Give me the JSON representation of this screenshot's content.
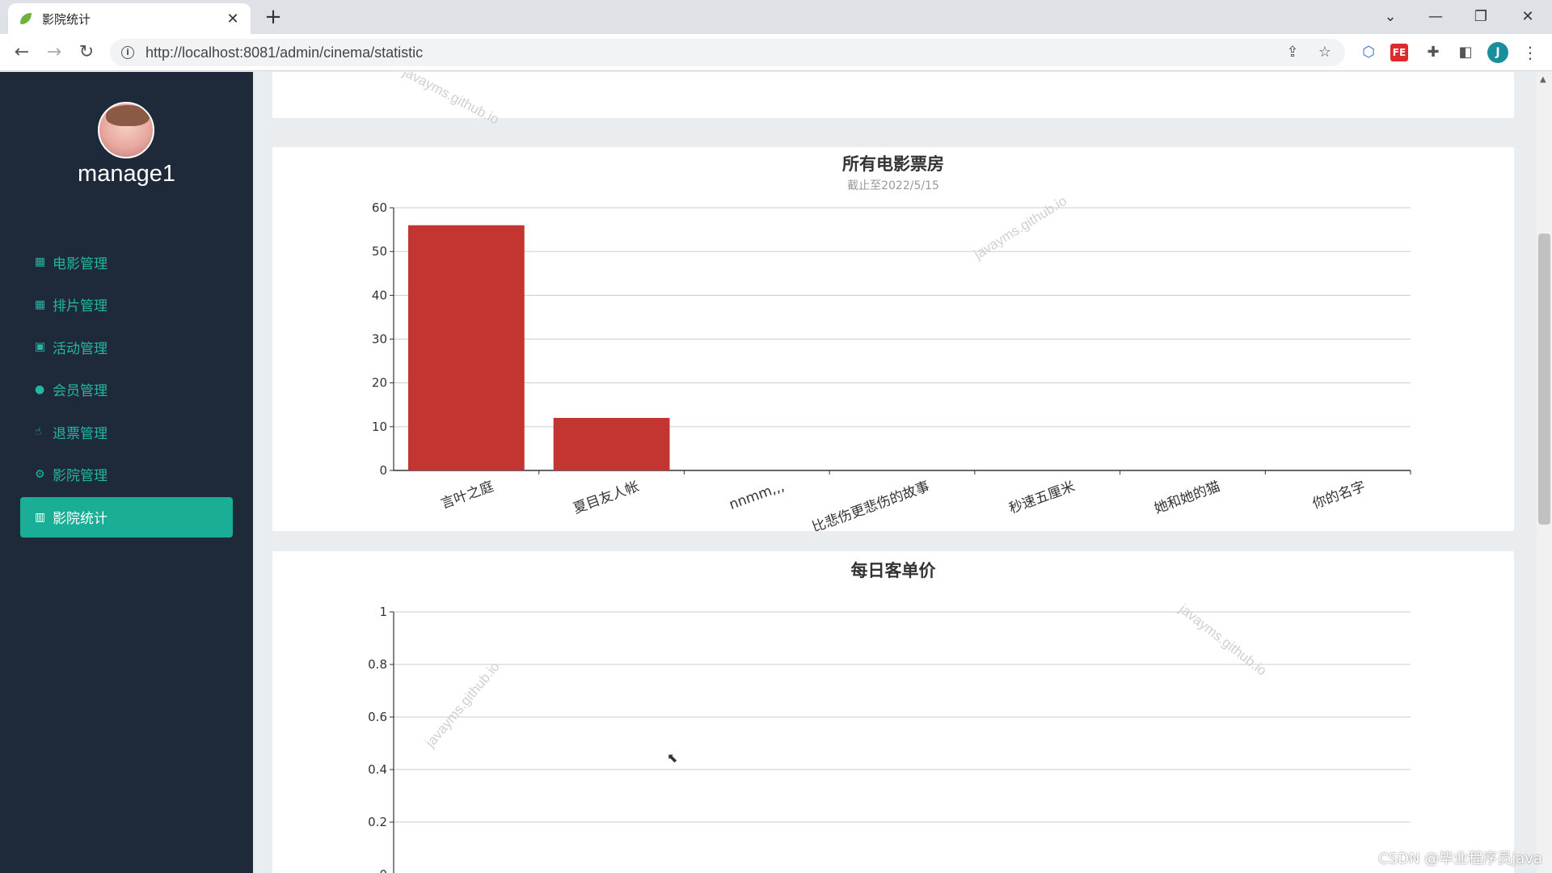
{
  "browser": {
    "tab_title": "影院统计",
    "url": "http://localhost:8081/admin/cinema/statistic",
    "profile_initial": "J"
  },
  "sidebar": {
    "username": "manage1",
    "items": [
      {
        "label": "电影管理",
        "icon": "film-icon",
        "glyph": "▦"
      },
      {
        "label": "排片管理",
        "icon": "calendar-icon",
        "glyph": "▦"
      },
      {
        "label": "活动管理",
        "icon": "gift-icon",
        "glyph": "▣"
      },
      {
        "label": "会员管理",
        "icon": "user-icon",
        "glyph": "●"
      },
      {
        "label": "退票管理",
        "icon": "hand-icon",
        "glyph": "☝"
      },
      {
        "label": "影院管理",
        "icon": "cogs-icon",
        "glyph": "⚙"
      },
      {
        "label": "影院统计",
        "icon": "bar-chart-icon",
        "glyph": "▥",
        "active": true
      }
    ],
    "accent": "#1aae97"
  },
  "watermark": "javayms.github.io",
  "footer_mark": "CSDN @毕业程序员java",
  "chart_data": [
    {
      "type": "bar",
      "title": "所有电影票房",
      "subtitle": "截止至2022/5/15",
      "categories": [
        "言叶之庭",
        "夏目友人帐",
        "nnmm,,,",
        "比悲伤更悲伤的故事",
        "秒速五厘米",
        "她和她的猫",
        "你的名字"
      ],
      "values": [
        56,
        12,
        0,
        0,
        0,
        0,
        0
      ],
      "ylim": [
        0,
        60
      ],
      "yticks": [
        0,
        10,
        20,
        30,
        40,
        50,
        60
      ],
      "color": "#c23531",
      "grid": true
    },
    {
      "type": "line",
      "title": "每日客单价",
      "ylim": [
        0,
        1
      ],
      "yticks": [
        "0",
        "0.2",
        "0.4",
        "0.6",
        "0.8",
        "1"
      ],
      "color": "#c23531",
      "grid": true
    }
  ]
}
